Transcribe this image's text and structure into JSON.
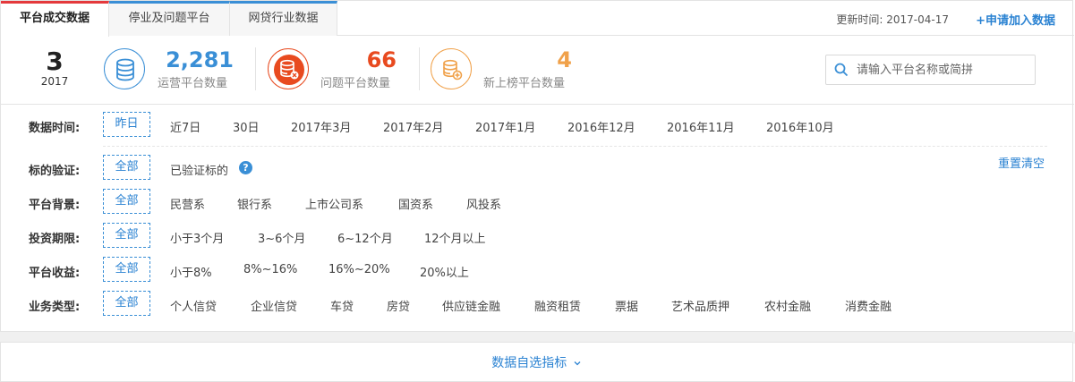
{
  "tabs": [
    {
      "label": "平台成交数据",
      "active": true
    },
    {
      "label": "停业及问题平台",
      "active": false
    },
    {
      "label": "网贷行业数据",
      "active": false
    }
  ],
  "header": {
    "update_time": "更新时间: 2017-04-17",
    "apply_link": "+申请加入数据"
  },
  "stats": {
    "month_number": "3",
    "year": "2017",
    "items": [
      {
        "value": "2,281",
        "label": "运营平台数量",
        "color": "#3a8fd6",
        "icon": "database-icon"
      },
      {
        "value": "66",
        "label": "问题平台数量",
        "color": "#e84a1f",
        "icon": "database-error-icon"
      },
      {
        "value": "4",
        "label": "新上榜平台数量",
        "color": "#f0a14a",
        "icon": "database-add-icon"
      }
    ]
  },
  "search": {
    "placeholder": "请输入平台名称或简拼"
  },
  "filters": {
    "time": {
      "label": "数据时间:",
      "selected": "昨日",
      "options": [
        "近7日",
        "30日",
        "2017年3月",
        "2017年2月",
        "2017年1月",
        "2016年12月",
        "2016年11月",
        "2016年10月"
      ]
    },
    "verify": {
      "label": "标的验证:",
      "selected": "全部",
      "options": [
        "已验证标的"
      ]
    },
    "background": {
      "label": "平台背景:",
      "selected": "全部",
      "options": [
        "民营系",
        "银行系",
        "上市公司系",
        "国资系",
        "风投系"
      ]
    },
    "term": {
      "label": "投资期限:",
      "selected": "全部",
      "options": [
        "小于3个月",
        "3~6个月",
        "6~12个月",
        "12个月以上"
      ]
    },
    "yield": {
      "label": "平台收益:",
      "selected": "全部",
      "options": [
        "小于8%",
        "8%~16%",
        "16%~20%",
        "20%以上"
      ]
    },
    "business": {
      "label": "业务类型:",
      "selected": "全部",
      "options": [
        "个人信贷",
        "企业信贷",
        "车贷",
        "房贷",
        "供应链金融",
        "融资租赁",
        "票据",
        "艺术品质押",
        "农村金融",
        "消费金融"
      ]
    },
    "reset_label": "重置清空"
  },
  "bottom": {
    "indicator_label": "数据自选指标"
  },
  "colors": {
    "accent": "#2a82d2",
    "active_tab": "#e4393c"
  }
}
